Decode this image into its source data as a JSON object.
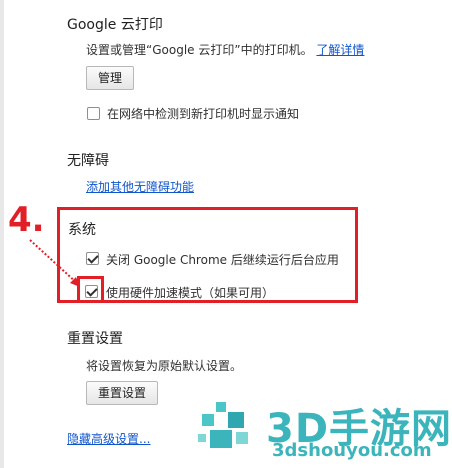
{
  "cloud_print": {
    "title": "Google 云打印",
    "description": "设置或管理“Google 云打印”中的打印机。",
    "learn_more": "了解详情",
    "manage_button": "管理",
    "notify_label": "在网络中检测到新打印机时显示通知",
    "notify_checked": false
  },
  "accessibility": {
    "title": "无障碍",
    "add_link": "添加其他无障碍功能"
  },
  "system": {
    "title": "系统",
    "background_label": "关闭 Google Chrome 后继续运行后台应用",
    "background_checked": true,
    "hardware_label": "使用硬件加速模式（如果可用）",
    "hardware_checked": true
  },
  "reset": {
    "title": "重置设置",
    "description": "将设置恢复为原始默认设置。",
    "reset_button": "重置设置"
  },
  "footer": {
    "hide_advanced": "隐藏高级设置..."
  },
  "annotation": {
    "step_number": "4.",
    "highlight_color": "#e21e26"
  },
  "watermark": {
    "brand": "3D手游网",
    "url": "3dshouyou.com"
  }
}
